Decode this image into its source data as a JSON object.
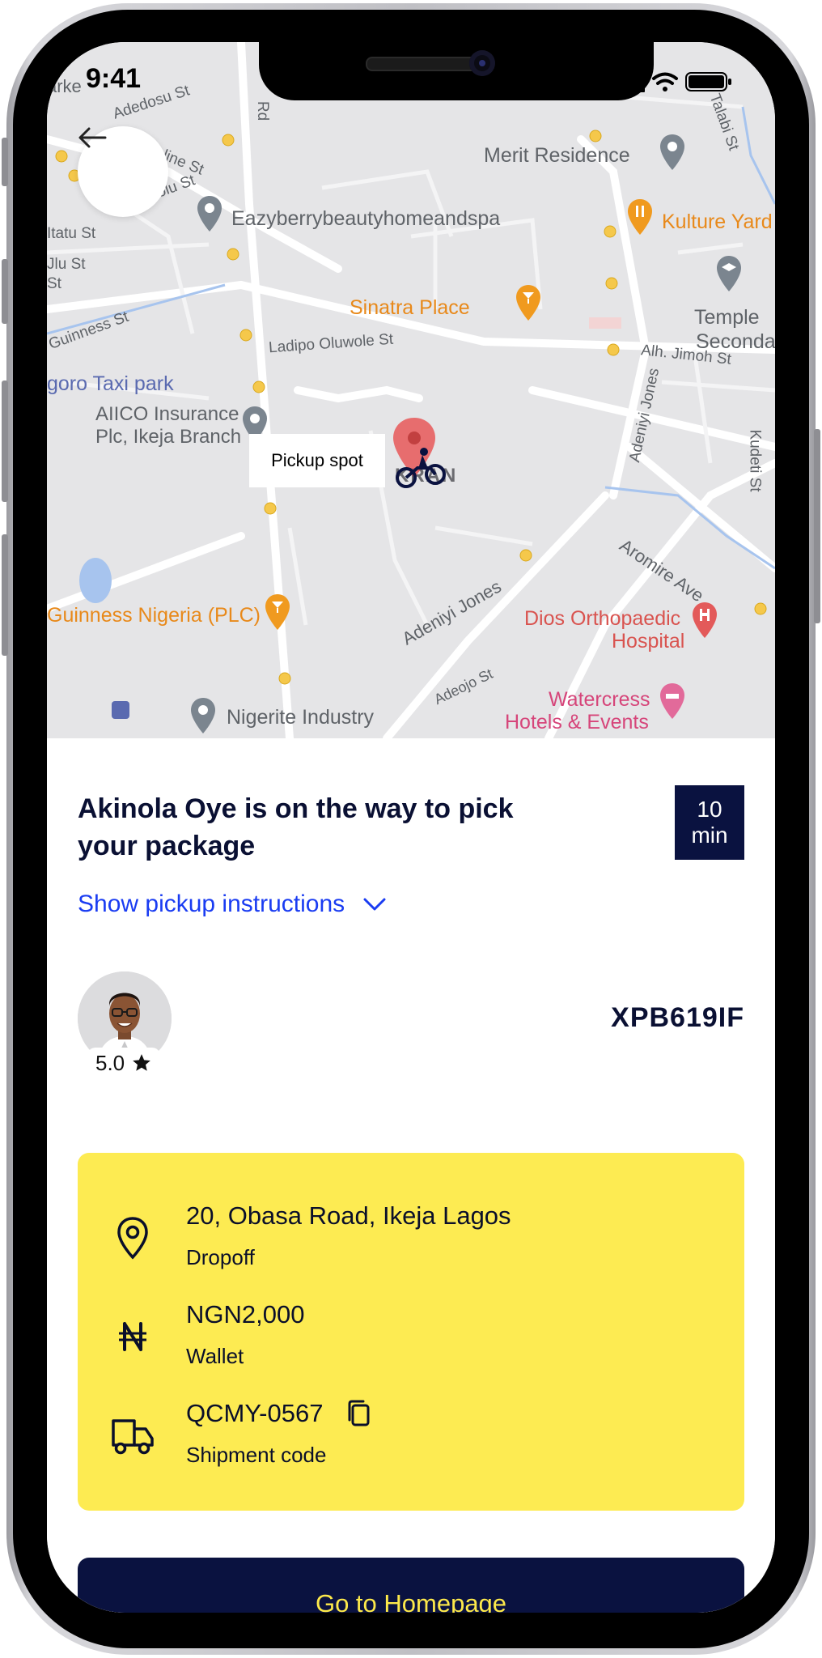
{
  "status_bar": {
    "time": "9:41"
  },
  "map": {
    "pickup_label": "Pickup spot",
    "streets": [
      "Adedosu St",
      "Rd",
      "Nepaline St",
      "Moroufolu St",
      "Talabi St",
      "Itatu St",
      "Jlu St",
      "St",
      "Guinness St",
      "Ladipo Oluwole St",
      "Alh. Jimoh St",
      "Adeniyi Jones",
      "Kudeti St",
      "Aromire Ave",
      "Adeniyi Jones",
      "Adeojo St",
      "KRAN",
      "arke"
    ],
    "places": [
      {
        "name": "Merit Residence",
        "color": "#5f6368"
      },
      {
        "name": "Kulture Yard",
        "color": "#e8891a"
      },
      {
        "name": "Eazyberrybeautyhomeandspa",
        "color": "#5f6368"
      },
      {
        "name": "Sinatra Place",
        "color": "#e8891a"
      },
      {
        "name": "Temple",
        "color": "#5f6368"
      },
      {
        "name": "Secondary",
        "color": "#5f6368"
      },
      {
        "name": "goro Taxi park",
        "color": "#5a6ab0"
      },
      {
        "name": "AIICO Insurance",
        "color": "#5f6368"
      },
      {
        "name": "Plc, Ikeja Branch",
        "color": "#5f6368"
      },
      {
        "name": "Guinness Nigeria (PLC)",
        "color": "#e8891a"
      },
      {
        "name": "Dios Orthopaedic",
        "color": "#d9534f"
      },
      {
        "name": "Hospital",
        "color": "#d9534f"
      },
      {
        "name": "Watercress",
        "color": "#d6457a"
      },
      {
        "name": "Hotels & Events",
        "color": "#d6457a"
      },
      {
        "name": "Nigerite Industry",
        "color": "#5f6368"
      }
    ]
  },
  "sheet": {
    "title": "Akinola Oye is on the way to pick your package",
    "eta_value": "10",
    "eta_unit": "min",
    "instructions_link": "Show pickup instructions",
    "rider_rating": "5.0",
    "plate": "XPB619IF"
  },
  "details": {
    "dropoff_address": "20, Obasa Road, Ikeja Lagos",
    "dropoff_label": "Dropoff",
    "amount": "NGN2,000",
    "payment_method": "Wallet",
    "shipment_code": "QCMY-0567",
    "shipment_label": "Shipment code"
  },
  "cta": {
    "home_label": "Go to Homepage"
  },
  "colors": {
    "navy": "#0a1240",
    "yellow_card": "#fdeb52",
    "link_blue": "#1a3cf2",
    "button_text": "#fde94a"
  }
}
